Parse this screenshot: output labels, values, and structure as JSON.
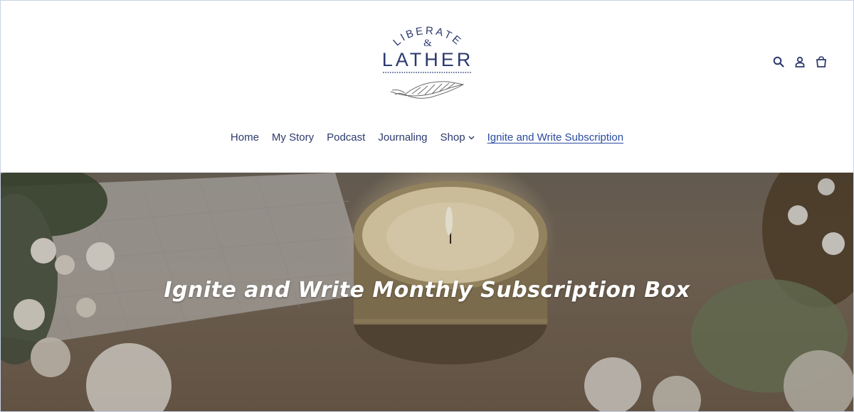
{
  "brand": {
    "logo_top_text": "LIBERATE",
    "logo_ampersand": "&",
    "logo_main_text": "LATHER"
  },
  "header_icons": {
    "search": "search-icon",
    "account": "account-icon",
    "cart": "cart-icon"
  },
  "nav": {
    "items": [
      {
        "label": "Home"
      },
      {
        "label": "My Story"
      },
      {
        "label": "Podcast"
      },
      {
        "label": "Journaling"
      },
      {
        "label": "Shop"
      },
      {
        "label": "Ignite and Write Subscription"
      }
    ]
  },
  "hero": {
    "title": "Ignite and Write Monthly Subscription Box"
  },
  "colors": {
    "brand_navy": "#2d3a6e",
    "active_link": "#2a4aa0"
  }
}
